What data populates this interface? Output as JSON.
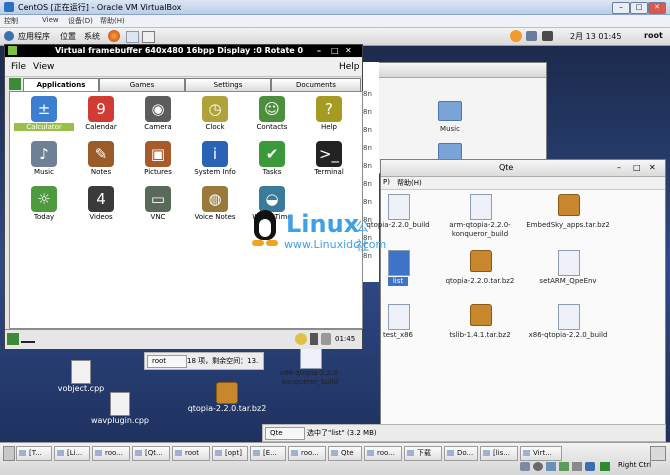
{
  "host": {
    "title": "CentOS [正在运行] - Oracle VM VirtualBox",
    "menu": [
      "控制",
      "View",
      "设备(D)",
      "帮助(H)"
    ],
    "min": "–",
    "max": "□",
    "close": "✕"
  },
  "gnome_panel": {
    "apps": "应用程序",
    "places": "位置",
    "system": "系统",
    "clock": "2月 13 01:45",
    "user": "root"
  },
  "vfb": {
    "title": "Virtual framebuffer 640x480 16bpp Display :0 Rotate 0",
    "menu": {
      "file": "File",
      "view": "View",
      "help": "Help"
    },
    "tabs": [
      "Applications",
      "Games",
      "Settings",
      "Documents"
    ],
    "apps": [
      {
        "name": "Calculator",
        "glyph": "±",
        "color": "#3c7fd0"
      },
      {
        "name": "Calendar",
        "glyph": "9",
        "color": "#d23a34"
      },
      {
        "name": "Camera",
        "glyph": "◉",
        "color": "#5c5c5c"
      },
      {
        "name": "Clock",
        "glyph": "◷",
        "color": "#b0a23a"
      },
      {
        "name": "Contacts",
        "glyph": "☺",
        "color": "#4c8f3c"
      },
      {
        "name": "Help",
        "glyph": "?",
        "color": "#a59a22"
      },
      {
        "name": "Music",
        "glyph": "♪",
        "color": "#6f7f96"
      },
      {
        "name": "Notes",
        "glyph": "✎",
        "color": "#9a5b2a"
      },
      {
        "name": "Pictures",
        "glyph": "▣",
        "color": "#a85a2a"
      },
      {
        "name": "System Info",
        "glyph": "i",
        "color": "#2a63b5"
      },
      {
        "name": "Tasks",
        "glyph": "✔",
        "color": "#3a9a3a"
      },
      {
        "name": "Terminal",
        "glyph": ">_",
        "color": "#222222"
      },
      {
        "name": "Today",
        "glyph": "☼",
        "color": "#4e9a3e"
      },
      {
        "name": "Videos",
        "glyph": "4",
        "color": "#3a3a3a"
      },
      {
        "name": "VNC",
        "glyph": "▭",
        "color": "#5a6a5a"
      },
      {
        "name": "Voice Notes",
        "glyph": "◍",
        "color": "#9a7a3a"
      },
      {
        "name": "World Time",
        "glyph": "◒",
        "color": "#3a7a9a"
      }
    ],
    "clock": "01:45"
  },
  "filemanager": {
    "music": "Music",
    "left_strip": [
      "8n",
      "8n",
      "8n",
      "8n",
      "8n",
      "8n",
      "8n",
      "8n",
      "8n",
      "8n",
      "8n",
      "8n"
    ]
  },
  "qte": {
    "title": "Qte",
    "menu_help": "帮助(H)",
    "menu_prefix": "P)",
    "files": [
      {
        "name": "qtopia-2.2.0_build",
        "type": "file"
      },
      {
        "name": "arm-qtopia-2.2.0-konqueror_build",
        "type": "file"
      },
      {
        "name": "EmbedSky_apps.tar.bz2",
        "type": "tar"
      },
      {
        "name": "list",
        "type": "file"
      },
      {
        "name": "qtopia-2.2.0.tar.bz2",
        "type": "tar"
      },
      {
        "name": "setARM_QpeEnv",
        "type": "file"
      },
      {
        "name": "test_x86",
        "type": "file"
      },
      {
        "name": "tslib-1.4.1.tar.bz2",
        "type": "tar"
      },
      {
        "name": "x86-qtopia-2.2.0_build",
        "type": "file"
      },
      {
        "name": "x86-qtopia-2.2.0-konqueror_build",
        "type": "file"
      }
    ],
    "status_root": "root",
    "status_text": "18 项，剩余空间：13.",
    "location": "Qte",
    "selection": "选中了\"list\" (3.2 MB)"
  },
  "desktop_icons": [
    {
      "name": "vobject.cpp"
    },
    {
      "name": "wavplugin.cpp"
    },
    {
      "name": "qtopia-2.2.0.tar.bz2"
    }
  ],
  "logo": {
    "brand": "Linux",
    "suffix": "公社",
    "url": "www.Linuxidc.com"
  },
  "taskbar": [
    "[T...",
    "[Li...",
    "roo...",
    "[Qt...",
    "root",
    "[opt]",
    "[E...",
    "roo...",
    "Qte",
    "roo...",
    "下载",
    "Do...",
    "[lis...",
    "Virt..."
  ],
  "tray": {
    "indicator": "Right Ctrl"
  }
}
